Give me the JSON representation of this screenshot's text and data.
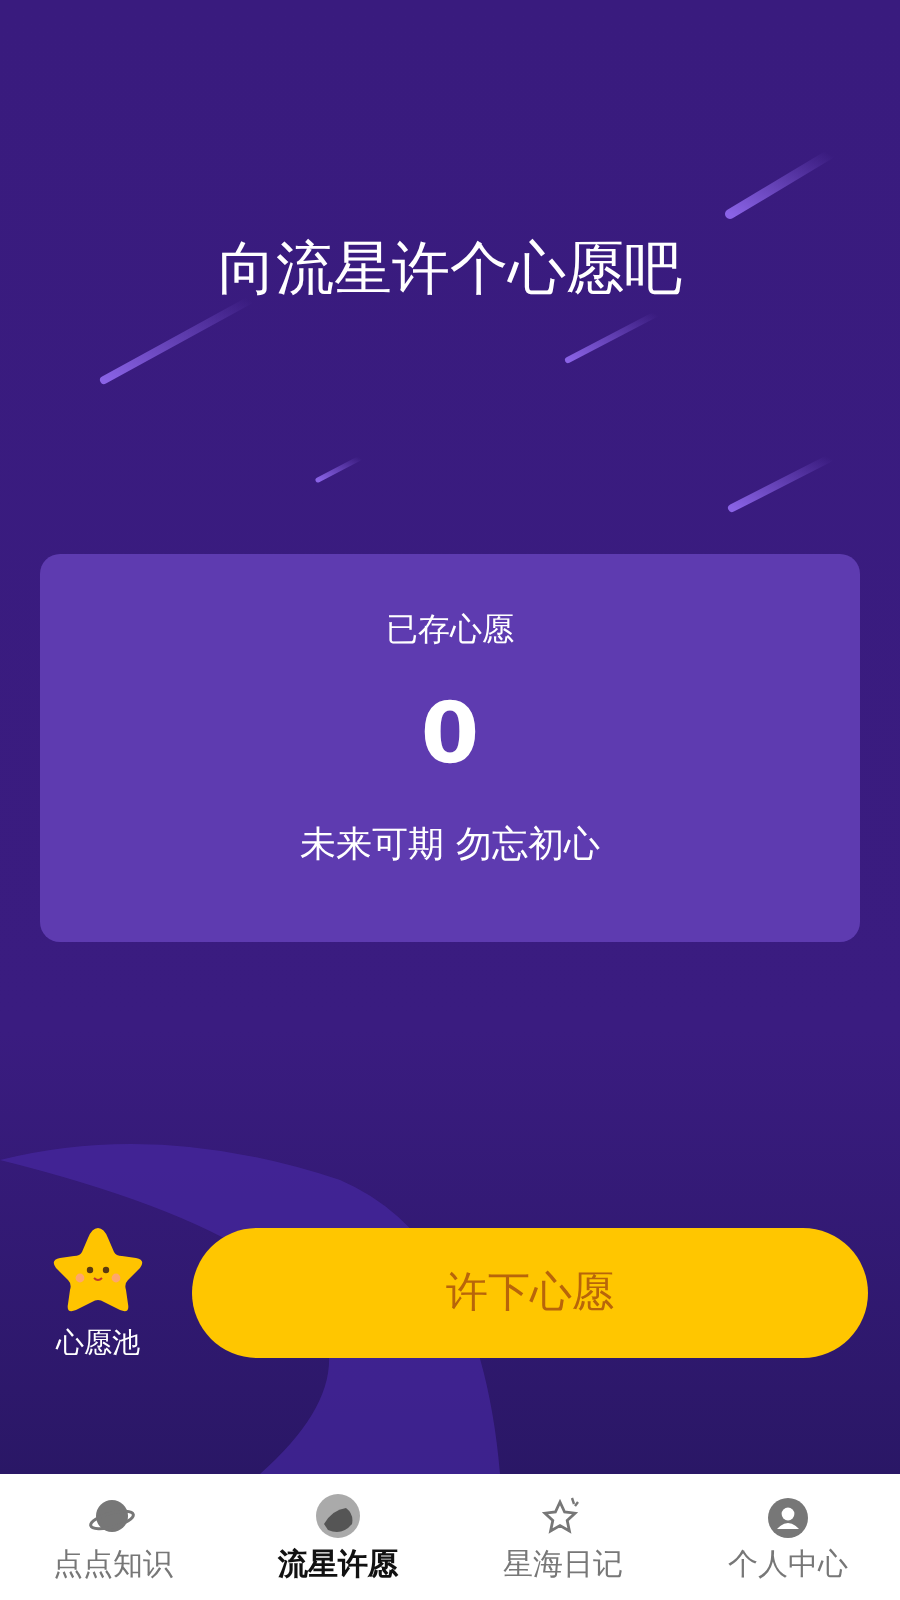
{
  "title": "向流星许个心愿吧",
  "wish_card": {
    "label": "已存心愿",
    "count": "0",
    "motto": "未来可期 勿忘初心"
  },
  "wish_pool": {
    "label": "心愿池"
  },
  "make_wish_button": {
    "label": "许下心愿"
  },
  "tabs": [
    {
      "label": "点点知识",
      "kind": "planet",
      "selected": false
    },
    {
      "label": "流星许愿",
      "kind": "meteor",
      "selected": true
    },
    {
      "label": "星海日记",
      "kind": "star",
      "selected": false
    },
    {
      "label": "个人中心",
      "kind": "person",
      "selected": false
    }
  ]
}
